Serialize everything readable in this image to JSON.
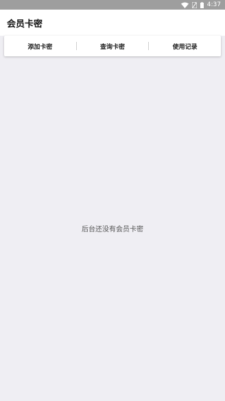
{
  "status_bar": {
    "time": "4:37",
    "icons": [
      "wifi-icon",
      "sim-icon",
      "battery-icon"
    ]
  },
  "header": {
    "title": "会员卡密"
  },
  "tabs": [
    {
      "label": "添加卡密"
    },
    {
      "label": "查询卡密"
    },
    {
      "label": "使用记录"
    }
  ],
  "main": {
    "empty_message": "后台还没有会员卡密"
  },
  "colors": {
    "status_bar": "#9e9e9e",
    "background": "#efeef3",
    "app_bar": "#ffffff"
  }
}
